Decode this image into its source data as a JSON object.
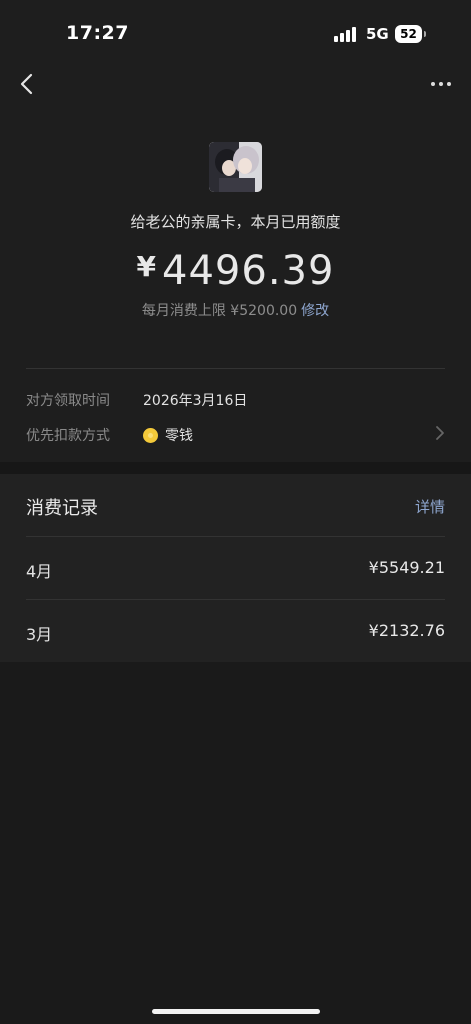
{
  "status_bar": {
    "time": "17:27",
    "network": "5G",
    "battery": "52"
  },
  "header": {
    "back_icon": "chevron-left-icon",
    "more_icon": "more-icon"
  },
  "card": {
    "title": "给老公的亲属卡，本月已用额度",
    "currency_symbol": "¥",
    "used_amount": "4496.39",
    "limit_label": "每月消费上限 ¥5200.00",
    "edit_label": "修改"
  },
  "info": {
    "claim_time_label": "对方领取时间",
    "claim_time_value": "2026年3月16日",
    "payment_method_label": "优先扣款方式",
    "payment_method_value": "零钱"
  },
  "records": {
    "title": "消费记录",
    "detail_label": "详情",
    "items": [
      {
        "month": "4月",
        "amount": "¥5549.21"
      },
      {
        "month": "3月",
        "amount": "¥2132.76"
      }
    ]
  },
  "colors": {
    "background": "#1e1e1e",
    "link": "#8ea6cf",
    "coin": "#f3c93a"
  }
}
